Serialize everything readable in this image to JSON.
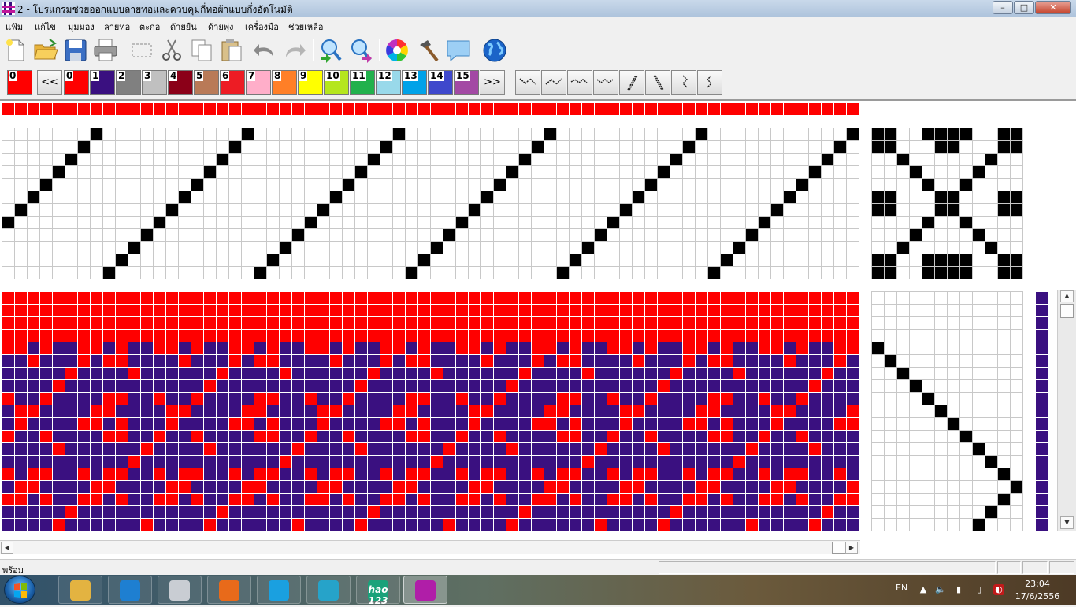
{
  "window": {
    "title": "2 - โปรแกรมช่วยออกแบบลายทอและควบคุมกี่ทอผ้าแบบกึ่งอัตโนมัติ",
    "minimize_label": "–",
    "maximize_label": "□",
    "close_label": "✕"
  },
  "menu": [
    "แฟ้ม",
    "แก้ไข",
    "มุมมอง",
    "ลายทอ",
    "ตะกอ",
    "ด้ายยืน",
    "ด้ายพุ่ง",
    "เครื่องมือ",
    "ช่วยเหลือ"
  ],
  "toolbar": {
    "icons": [
      "new-icon",
      "open-icon",
      "save-icon",
      "print-icon",
      "select-icon",
      "cut-icon",
      "copy-icon",
      "paste-icon",
      "undo-icon",
      "redo-icon",
      "zoom-in-icon",
      "zoom-out-icon",
      "color-wheel-icon",
      "hammer-icon",
      "comment-icon",
      "globe-icon"
    ]
  },
  "palette": {
    "current": {
      "label": "0",
      "color": "#ff0000"
    },
    "prev_label": "<<",
    "next_label": ">>",
    "colors": [
      {
        "label": "0",
        "color": "#ff0000"
      },
      {
        "label": "1",
        "color": "#3a1080"
      },
      {
        "label": "2",
        "color": "#808080"
      },
      {
        "label": "3",
        "color": "#c0c0c0"
      },
      {
        "label": "4",
        "color": "#8b0018"
      },
      {
        "label": "5",
        "color": "#b97a57"
      },
      {
        "label": "6",
        "color": "#ed1c24"
      },
      {
        "label": "7",
        "color": "#ffaec9"
      },
      {
        "label": "8",
        "color": "#ff7f27"
      },
      {
        "label": "9",
        "color": "#ffff00"
      },
      {
        "label": "10",
        "color": "#b5e61d"
      },
      {
        "label": "11",
        "color": "#22b14c"
      },
      {
        "label": "12",
        "color": "#99d9ea"
      },
      {
        "label": "13",
        "color": "#00a2e8"
      },
      {
        "label": "14",
        "color": "#3f48cc"
      },
      {
        "label": "15",
        "color": "#a349a4"
      }
    ],
    "weave_tools": [
      "twill-left-icon",
      "twill-right-icon",
      "wave-icon",
      "zigzag-icon",
      "diagonal-steep-icon",
      "diagonal-steep-back-icon",
      "point-vertical-icon",
      "point-vertical-back-icon"
    ]
  },
  "colors": {
    "warp": "#ff0000",
    "weft": "#3a1080",
    "grid": "#c8c8c8",
    "mark": "#000000"
  },
  "status": {
    "text": "พร้อม"
  },
  "taskbar": {
    "apps": [
      {
        "name": "explorer",
        "label": ""
      },
      {
        "name": "internet-explorer",
        "label": ""
      },
      {
        "name": "calculator",
        "label": ""
      },
      {
        "name": "firefox",
        "label": ""
      },
      {
        "name": "skype",
        "label": ""
      },
      {
        "name": "health-app",
        "label": ""
      },
      {
        "name": "hao123",
        "label": "hao 123"
      },
      {
        "name": "weaving-app",
        "label": ""
      }
    ],
    "lang": "EN",
    "time": "23:04",
    "date": "17/6/2556"
  }
}
